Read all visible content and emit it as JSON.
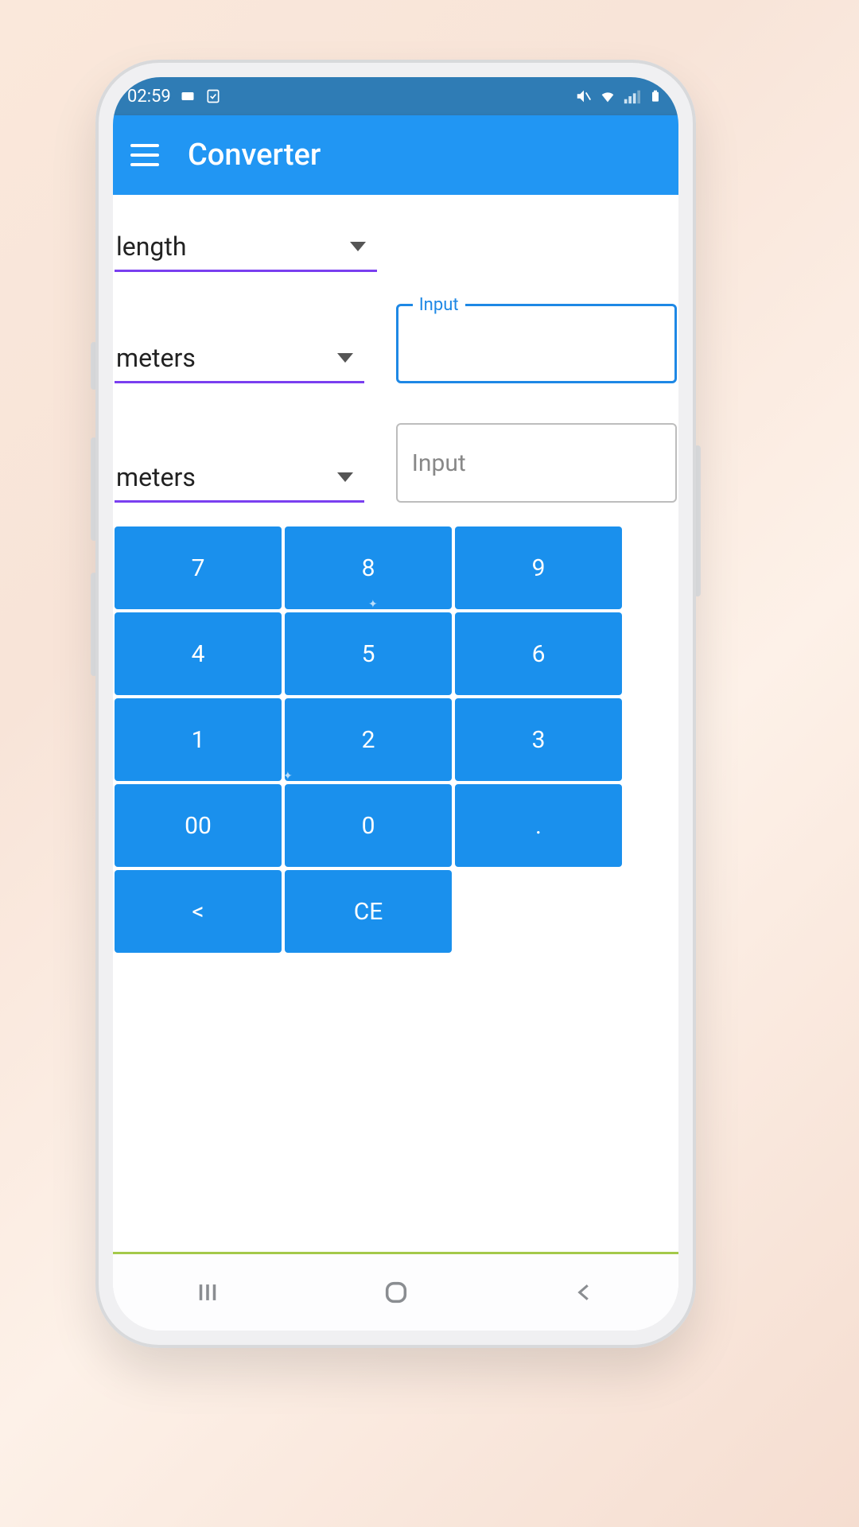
{
  "status": {
    "time": "02:59"
  },
  "appbar": {
    "title": "Converter"
  },
  "selectors": {
    "category": "length",
    "from_unit": "meters",
    "to_unit": "meters"
  },
  "inputs": {
    "from_label": "Input",
    "from_value": "",
    "to_placeholder": "Input",
    "to_value": ""
  },
  "keypad": {
    "k7": "7",
    "k8": "8",
    "k9": "9",
    "k4": "4",
    "k5": "5",
    "k6": "6",
    "k1": "1",
    "k2": "2",
    "k3": "3",
    "k00": "00",
    "k0": "0",
    "kdot": ".",
    "kback": "<",
    "kce": "CE"
  }
}
